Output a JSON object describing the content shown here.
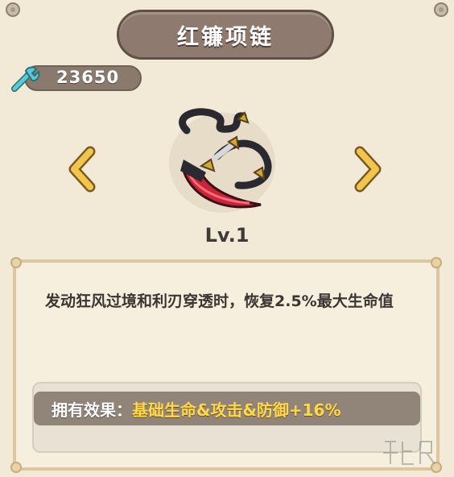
{
  "header": {
    "title": "红镰项链"
  },
  "currency": {
    "amount": "23650",
    "icon": "wrench-icon"
  },
  "item": {
    "name": "红镰项链",
    "level": "Lv.1",
    "description": "发动狂风过境和利刃穿透时，恢复2.5%最大生命值",
    "owned_effect_label": "拥有效果：",
    "owned_effect_value": "基础生命&攻击&防御+16%"
  },
  "colors": {
    "background": "#f2e9d6",
    "banner": "#8e7a6e",
    "effect_bar": "#918478",
    "effect_value": "#ffd84a",
    "arrow": "#f0c24a",
    "currency_icon": "#4fc6d6"
  },
  "nav": {
    "prev_icon": "chevron-left-icon",
    "next_icon": "chevron-right-icon"
  }
}
